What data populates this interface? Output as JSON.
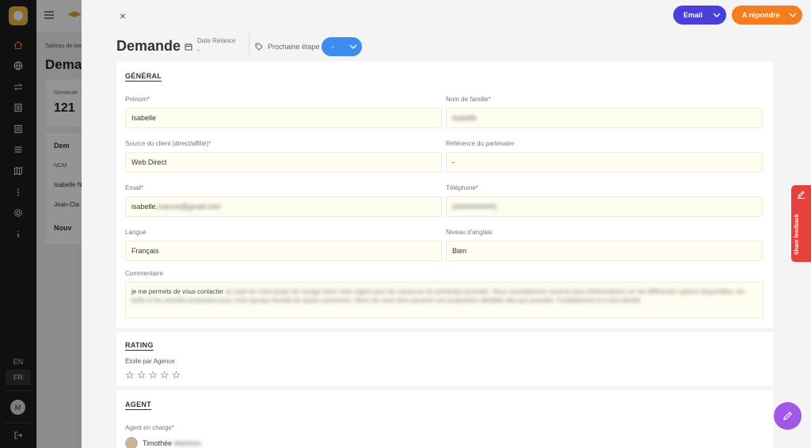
{
  "rail": {
    "lang_en": "EN",
    "lang_fr": "FR",
    "avatar_initial": "M",
    "icons": [
      "home-icon",
      "globe-icon",
      "transfer-icon",
      "document-icon",
      "document-icon",
      "list-icon",
      "map-icon",
      "more-vertical-icon",
      "settings-icon",
      "info-icon"
    ]
  },
  "background_page": {
    "breadcrumb": "Tableau de bord",
    "title": "Dema",
    "card_label": "Demande",
    "card_value": "121",
    "list_header": "Dem",
    "col_name": "NOM",
    "row1": "Isabelle N",
    "row2": "Jean-Cla",
    "section2": "Nouv"
  },
  "drawer": {
    "close": "×",
    "email_button": "Email",
    "reply_button": "A répondre",
    "title": "Demande",
    "relance_label": "Date Relance",
    "relance_value": "-",
    "next_step_label": "Prochaine étape",
    "next_step_value": "-"
  },
  "general": {
    "section_title": "GÉNÉRAL",
    "first_name_label": "Prénom*",
    "first_name_value": "Isabelle",
    "last_name_label": "Nom de famille*",
    "last_name_value": "Isabelle",
    "source_label": "Source du client (direct/affilié)*",
    "source_value": "Web Direct",
    "partner_ref_label": "Référence du partenaire",
    "partner_ref_value": "-",
    "email_label": "Email*",
    "email_value": "isabelle.",
    "email_value_blurred": "marcus@gmail.com",
    "phone_label": "Téléphone*",
    "phone_value": "(##########)",
    "language_label": "Langue",
    "language_value": "Français",
    "english_label": "Niveau d'anglais",
    "english_value": "Bien",
    "comment_label": "Commentaire",
    "comment_value": "je me permets de vous contacter",
    "comment_blurred": "au sujet de notre projet de voyage dans votre région pour les vacances de printemps prochain. Nous souhaiterions recevoir plus d'informations sur les différentes options disponibles, les tarifs et les activités proposées pour notre groupe familial de quatre personnes. Merci de nous faire parvenir une proposition détaillée dès que possible. Cordialement et à très bientôt."
  },
  "rating": {
    "section_title": "RATING",
    "stars_label": "Étoile par Agence",
    "stars_value": 0,
    "stars_max": 5
  },
  "agent": {
    "section_title": "AGENT",
    "agent_label": "Agent en charge*",
    "agent_first": "Timothée",
    "agent_last": "Martinez"
  },
  "feedback": {
    "label": "Share feedback"
  }
}
